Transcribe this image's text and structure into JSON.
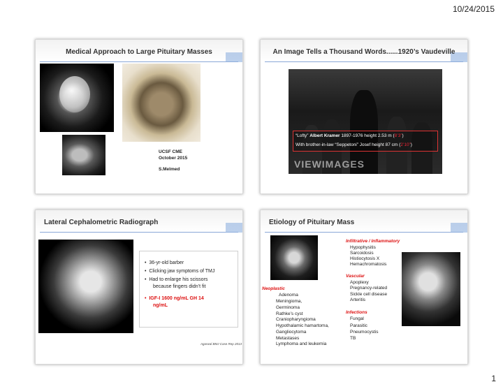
{
  "header": {
    "date": "10/24/2015"
  },
  "footer": {
    "page_number": "1"
  },
  "slide1": {
    "title": "Medical Approach to Large Pituitary Masses",
    "credit": {
      "line1": "UCSF CME",
      "line2": "October 2015",
      "line3": "S.Melmed"
    }
  },
  "slide2": {
    "title": "An Image Tells a Thousand Words......1920’s Vaudeville",
    "caption1": {
      "prefix": "“Lofty”",
      "name": "Albert Kramer",
      "details": "1897-1976 height 2.53 m (",
      "red": "8’3”",
      "suffix": ")"
    },
    "caption2": {
      "text": "With brother-in-law “Seppetoni” Josef  height 87 cm (",
      "red": "2’10”",
      "suffix": ")"
    },
    "watermark": "VIEWIMAGES"
  },
  "slide3": {
    "title": "Lateral Cephalometric Radiograph",
    "bullets": [
      "36-yr-old barber",
      "Clicking jaw symptoms of TMJ",
      "Had to enlarge his scissors",
      "because fingers didn’t fit"
    ],
    "highlight": {
      "line1": "IGF-I 1600 ng/mL GH 14",
      "line2": "ng/mL"
    },
    "citation": "Agarwal BMJ Case Rep 2013"
  },
  "slide4": {
    "title": "Etiology of Pituitary Mass",
    "infiltrative": {
      "heading": "Infiltrative / Inflammatory",
      "items": [
        "Hypophysitis",
        "Sarcoidosis",
        "Histiocytosis X",
        "Hemachromatosis"
      ]
    },
    "vascular": {
      "heading": "Vascular",
      "items": [
        "Apoplexy",
        "Pregnancy-related",
        "Sickle cell disease",
        "Arteritis"
      ]
    },
    "neoplastic": {
      "heading": "Neoplastic",
      "items": [
        "Adenoma",
        "Meningioma,",
        "Germinoma",
        "Rathke’s cyst",
        "Craniopharyngioma",
        "Hypothalamic hamartoma,",
        "Gangliocytoma",
        "Metastases",
        "Lymphoma and leukemia"
      ]
    },
    "infections": {
      "heading": "Infections",
      "items": [
        "Fungal",
        "Parasitic",
        "Pneumocystis",
        "TB"
      ]
    }
  }
}
